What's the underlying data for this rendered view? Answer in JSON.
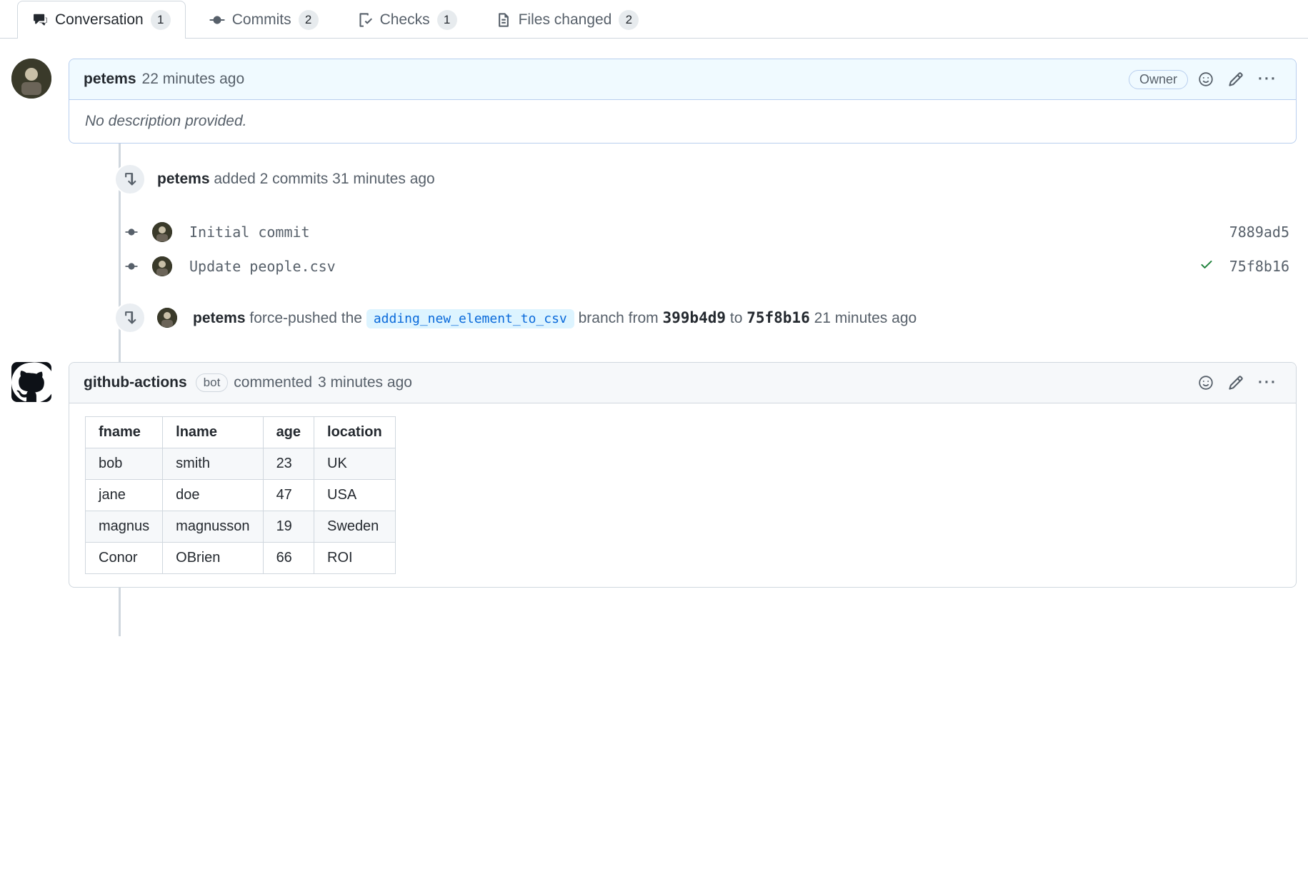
{
  "tabs": {
    "conversation": {
      "label": "Conversation",
      "count": "1"
    },
    "commits": {
      "label": "Commits",
      "count": "2"
    },
    "checks": {
      "label": "Checks",
      "count": "1"
    },
    "files": {
      "label": "Files changed",
      "count": "2"
    }
  },
  "comment1": {
    "author": "petems",
    "time": "22 minutes ago",
    "owner_label": "Owner",
    "body": "No description provided."
  },
  "commits_event": {
    "author": "petems",
    "action": "added 2 commits",
    "time": "31 minutes ago"
  },
  "commits": [
    {
      "message": "Initial commit",
      "sha": "7889ad5",
      "status": "none"
    },
    {
      "message": "Update people.csv",
      "sha": "75f8b16",
      "status": "success"
    }
  ],
  "force_push": {
    "author": "petems",
    "prefix": "force-pushed the",
    "branch": "adding_new_element_to_csv",
    "middle1": "branch from",
    "sha_from": "399b4d9",
    "middle2": "to",
    "sha_to": "75f8b16",
    "time": "21 minutes ago"
  },
  "comment2": {
    "author": "github-actions",
    "bot_label": "bot",
    "action": "commented",
    "time": "3 minutes ago"
  },
  "table": {
    "headers": [
      "fname",
      "lname",
      "age",
      "location"
    ],
    "rows": [
      [
        "bob",
        "smith",
        "23",
        "UK"
      ],
      [
        "jane",
        "doe",
        "47",
        "USA"
      ],
      [
        "magnus",
        "magnusson",
        "19",
        "Sweden"
      ],
      [
        "Conor",
        "OBrien",
        "66",
        "ROI"
      ]
    ]
  }
}
